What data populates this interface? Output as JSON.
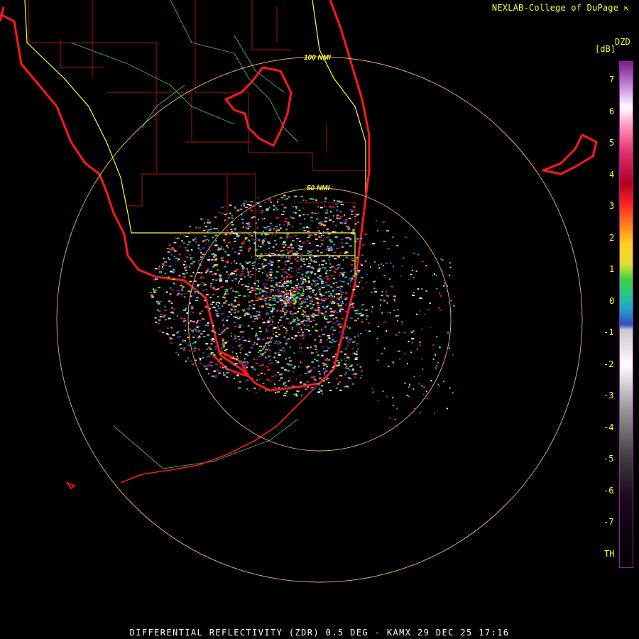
{
  "header": {
    "brand_label": "NEXLAB-College of DuPage",
    "brand_icon": "cursor-arrow-icon"
  },
  "legend": {
    "product": "DZD",
    "unit": "[dB]",
    "ticks": [
      "7",
      "6",
      "5",
      "4",
      "3",
      "2",
      "1",
      "0",
      "-1",
      "-2",
      "-3",
      "-4",
      "-5",
      "-6",
      "-7",
      "TH"
    ]
  },
  "range_rings": [
    {
      "label": "100 NMI"
    },
    {
      "label": "50 NMI"
    }
  ],
  "footer": {
    "caption": "DIFFERENTIAL REFLECTIVITY (ZDR) 0.5 DEG - KAMX 29 DEC 25 17:16"
  },
  "colors": {
    "background": "#000000",
    "coastline": "#ff2020",
    "county_lines": "#b01010",
    "state_lines": "#ffff33",
    "ring": "#f0b070",
    "text": "#ffff33"
  }
}
